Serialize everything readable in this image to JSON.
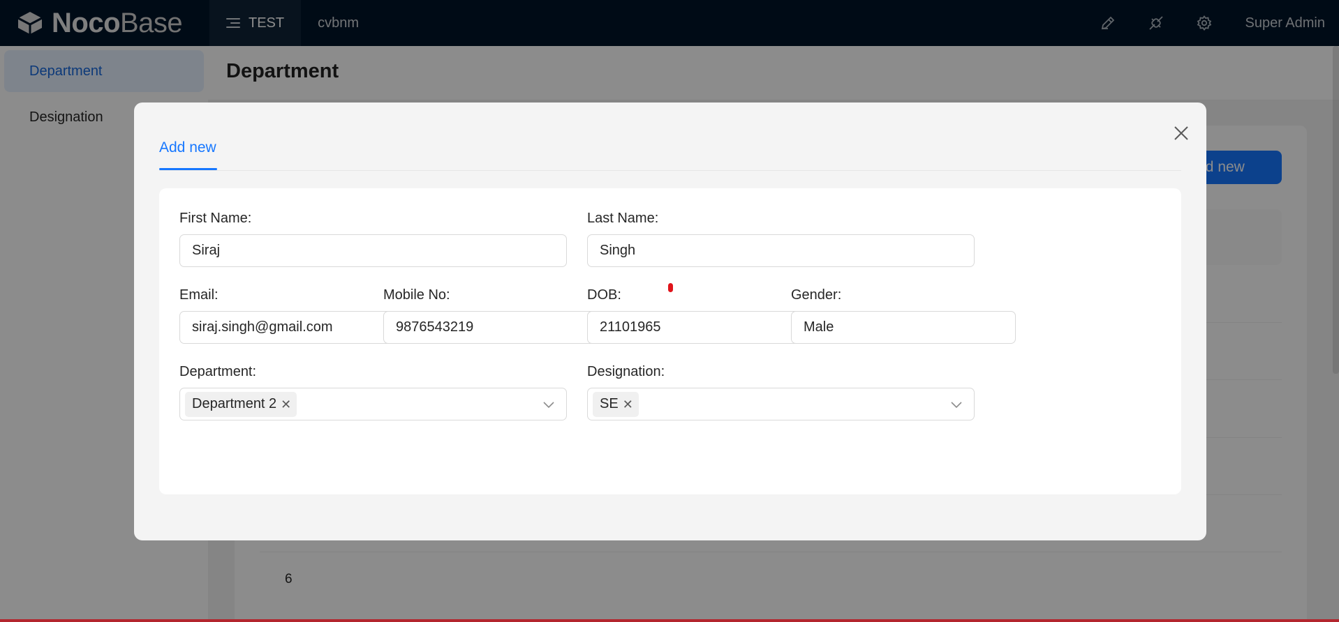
{
  "app": {
    "logo_bold": "Noco",
    "logo_light": "Base",
    "nav": [
      {
        "label": "TEST",
        "icon": "menu-icon",
        "active": true
      },
      {
        "label": "cvbnm",
        "active": false
      }
    ],
    "top_icons": [
      "brush-icon",
      "plugin-icon",
      "settings-icon"
    ],
    "user": "Super Admin"
  },
  "sidebar": {
    "items": [
      {
        "label": "Department",
        "selected": true
      },
      {
        "label": "Designation",
        "selected": false
      }
    ]
  },
  "page": {
    "title": "Department",
    "add_new_label": "Add new",
    "visible_row_number": "6"
  },
  "modal": {
    "tab_label": "Add new",
    "close_icon": "close-icon",
    "fields": {
      "first_name": {
        "label": "First Name",
        "value": "Siraj"
      },
      "last_name": {
        "label": "Last Name",
        "value": "Singh"
      },
      "email": {
        "label": "Email",
        "value": "siraj.singh@gmail.com"
      },
      "mobile": {
        "label": "Mobile No",
        "value": "9876543219"
      },
      "dob": {
        "label": "DOB",
        "value": "21101965"
      },
      "gender": {
        "label": "Gender",
        "value": "Male"
      },
      "department": {
        "label": "Department",
        "tags": [
          "Department 2"
        ]
      },
      "designation": {
        "label": "Designation",
        "tags": [
          "SE"
        ]
      }
    }
  },
  "colors": {
    "primary": "#1677ff",
    "header_bg": "#001529"
  }
}
